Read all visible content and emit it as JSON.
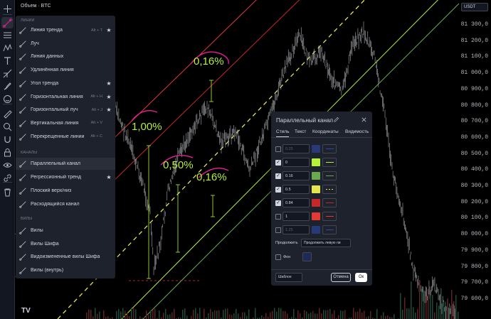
{
  "chart": {
    "title": "Объем · BTC",
    "currency": "USDT",
    "price_labels": [
      "81 300,0",
      "81 200,0",
      "81 100,0",
      "81 000,0",
      "80 900,0",
      "80 800,0",
      "80 700,0",
      "80 600,0",
      "80 500,0",
      "80 400,0",
      "80 300,0",
      "80 200,0",
      "80 100,0",
      "80 000,0",
      "79 900,0",
      "79 800,0",
      "79 700,0",
      "79 600,0"
    ],
    "logo": "TV",
    "annotations": [
      "0,16%",
      "1,00%",
      "0,50%",
      "0,16%"
    ],
    "colors": {
      "lime": "#b6f03a",
      "red": "#e53935",
      "magenta": "#e91e9c",
      "dash": "#e5e550"
    }
  },
  "toolbar": {
    "icons": [
      "crosshair-icon",
      "trendline-icon",
      "horizontal-lines-icon",
      "pattern-icon",
      "text-icon",
      "projection-icon",
      "brush-icon",
      "emoji-icon",
      "ruler-icon",
      "zoom-icon",
      "magnet-icon",
      "lock-icon",
      "eye-icon",
      "link-icon",
      "trash-icon"
    ]
  },
  "menu": {
    "sections": {
      "lines": "ЛИНИИ",
      "channels": "КАНАЛЫ",
      "pitchforks": "ВИЛЫ"
    },
    "lines": [
      {
        "label": "Линия тренда",
        "shortcut": "Alt + T",
        "star": true
      },
      {
        "label": "Луч",
        "shortcut": "",
        "star": false
      },
      {
        "label": "Линия данных",
        "shortcut": "",
        "star": false
      },
      {
        "label": "Удлинённая линия",
        "shortcut": "",
        "star": false
      },
      {
        "label": "Угол тренда",
        "shortcut": "",
        "star": true
      },
      {
        "label": "Горизонтальная линия",
        "shortcut": "Alt + H",
        "star": true
      },
      {
        "label": "Горизонтальный луч",
        "shortcut": "Alt + J",
        "star": true
      },
      {
        "label": "Вертикальная линия",
        "shortcut": "Alt + V",
        "star": false
      },
      {
        "label": "Перекрещенные линии",
        "shortcut": "Alt + C",
        "star": false
      }
    ],
    "channels": [
      {
        "label": "Параллельный канал"
      },
      {
        "label": "Регрессионный тренд",
        "star": true
      },
      {
        "label": "Плоский верх/низ"
      },
      {
        "label": "Расходящийся канал"
      }
    ],
    "pitchforks": [
      {
        "label": "Вилы"
      },
      {
        "label": "Вилы Шифа"
      },
      {
        "label": "Видоизмененные вилы Шифа"
      },
      {
        "label": "Вилы (внутрь)"
      }
    ]
  },
  "dialog": {
    "title": "Параллельный канал",
    "tabs": [
      "Стиль",
      "Текст",
      "Координаты",
      "Видимость"
    ],
    "levels": [
      {
        "value": "0.25",
        "checked": false,
        "dim": true,
        "color": "#2e4aa8",
        "line": "#2e4aa8",
        "dashed": false
      },
      {
        "value": "0",
        "checked": true,
        "dim": false,
        "color": "#b6f03a",
        "line": "#b6f03a",
        "dashed": false
      },
      {
        "value": "0.16",
        "checked": true,
        "dim": false,
        "color": "#6aa84f",
        "line": "#6aa84f",
        "dashed": false
      },
      {
        "value": "0.5",
        "checked": true,
        "dim": false,
        "color": "#e5e550",
        "line": "#e5e550",
        "dashed": true
      },
      {
        "value": "0.84",
        "checked": true,
        "dim": false,
        "color": "#c62828",
        "line": "#c62828",
        "dashed": false
      },
      {
        "value": "1",
        "checked": false,
        "dim": false,
        "color": "#e53935",
        "line": "#e53935",
        "dashed": false
      },
      {
        "value": "1.25",
        "checked": false,
        "dim": true,
        "color": "#2e4aa8",
        "line": "#2e4aa8",
        "dashed": false
      }
    ],
    "extend_label": "Продолжить",
    "extend_value": "Продолжить левую ли",
    "bg_label": "Фон",
    "template": "Шаблон",
    "cancel": "Отмена",
    "ok": "Ок"
  }
}
